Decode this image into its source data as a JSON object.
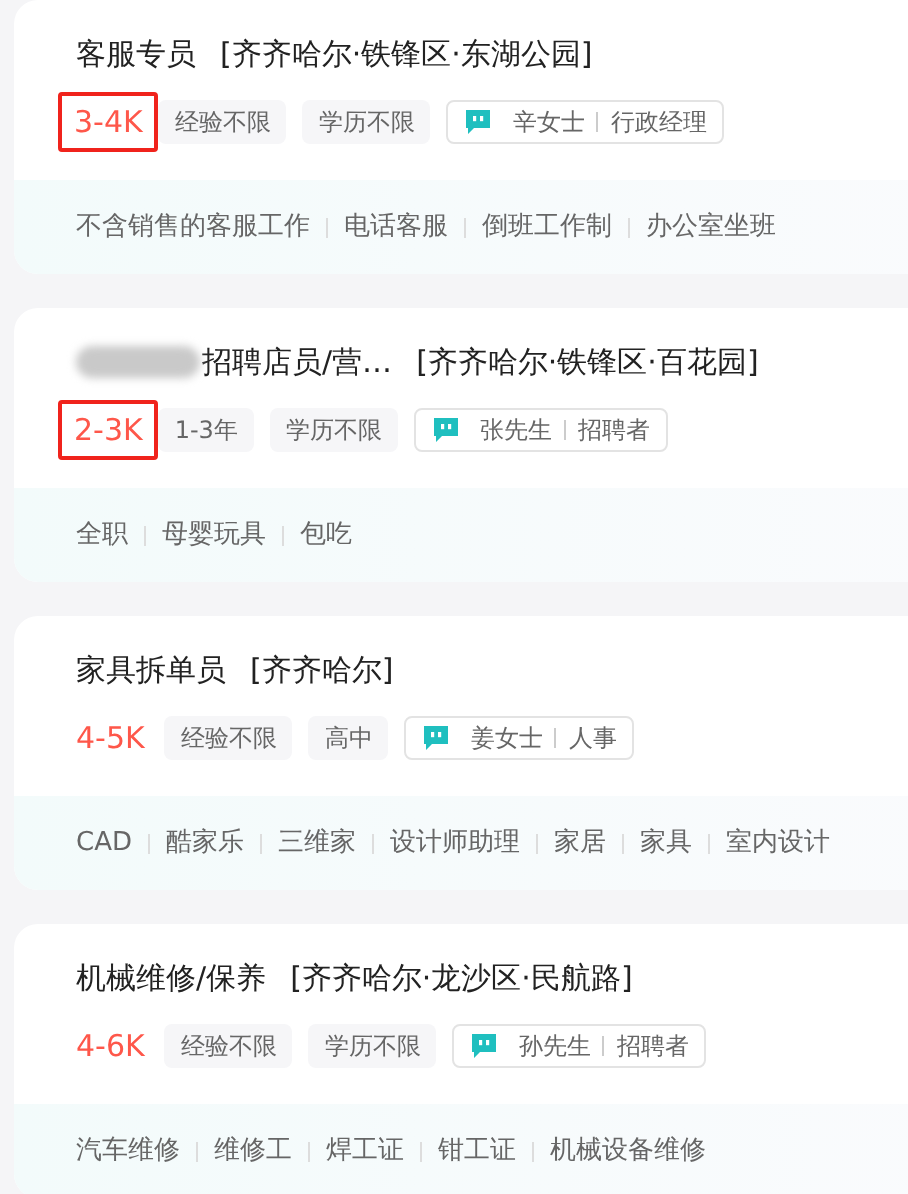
{
  "jobs": [
    {
      "title": "客服专员",
      "location": "[齐齐哈尔·铁锋区·东湖公园]",
      "title_redacted": false,
      "salary": "3-4K",
      "salary_highlighted": true,
      "requirements": [
        "经验不限",
        "学历不限"
      ],
      "recruiter": {
        "name": "辛女士",
        "role": "行政经理"
      },
      "tags": [
        "不含销售的客服工作",
        "电话客服",
        "倒班工作制",
        "办公室坐班"
      ]
    },
    {
      "title": "招聘店员/营…",
      "location": "[齐齐哈尔·铁锋区·百花园]",
      "title_redacted": true,
      "salary": "2-3K",
      "salary_highlighted": true,
      "requirements": [
        "1-3年",
        "学历不限"
      ],
      "recruiter": {
        "name": "张先生",
        "role": "招聘者"
      },
      "tags": [
        "全职",
        "母婴玩具",
        "包吃"
      ]
    },
    {
      "title": "家具拆单员",
      "location": "[齐齐哈尔]",
      "title_redacted": false,
      "salary": "4-5K",
      "salary_highlighted": false,
      "requirements": [
        "经验不限",
        "高中"
      ],
      "recruiter": {
        "name": "姜女士",
        "role": "人事"
      },
      "tags": [
        "CAD",
        "酷家乐",
        "三维家",
        "设计师助理",
        "家居",
        "家具",
        "室内设计"
      ]
    },
    {
      "title": "机械维修/保养",
      "location": "[齐齐哈尔·龙沙区·民航路]",
      "title_redacted": false,
      "salary": "4-6K",
      "salary_highlighted": false,
      "requirements": [
        "经验不限",
        "学历不限"
      ],
      "recruiter": {
        "name": "孙先生",
        "role": "招聘者"
      },
      "tags": [
        "汽车维修",
        "维修工",
        "焊工证",
        "钳工证",
        "机械设备维修"
      ]
    }
  ]
}
